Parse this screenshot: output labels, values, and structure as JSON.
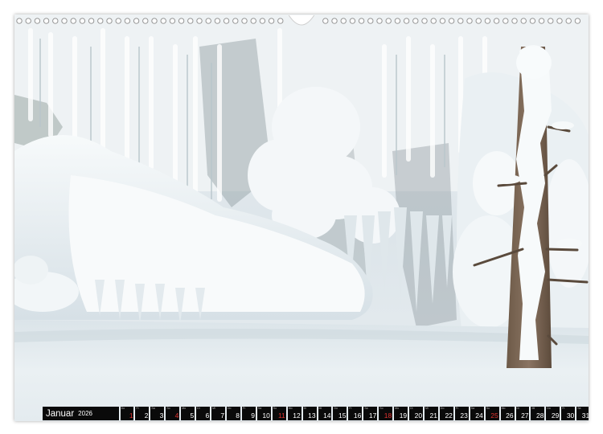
{
  "calendar": {
    "month": "Januar",
    "year": "2026",
    "accent_color": "#e0332f",
    "days": [
      {
        "n": "1",
        "wd": "Do",
        "holiday": true
      },
      {
        "n": "2",
        "wd": "Fr"
      },
      {
        "n": "3",
        "wd": "Sa"
      },
      {
        "n": "4",
        "wd": "So",
        "sunday": true
      },
      {
        "n": "5",
        "wd": "Mo"
      },
      {
        "n": "6",
        "wd": "Di"
      },
      {
        "n": "7",
        "wd": "Mi"
      },
      {
        "n": "8",
        "wd": "Do"
      },
      {
        "n": "9",
        "wd": "Fr"
      },
      {
        "n": "10",
        "wd": "Sa"
      },
      {
        "n": "11",
        "wd": "So",
        "sunday": true
      },
      {
        "n": "12",
        "wd": "Mo"
      },
      {
        "n": "13",
        "wd": "Di"
      },
      {
        "n": "14",
        "wd": "Mi"
      },
      {
        "n": "15",
        "wd": "Do"
      },
      {
        "n": "16",
        "wd": "Fr"
      },
      {
        "n": "17",
        "wd": "Sa"
      },
      {
        "n": "18",
        "wd": "So",
        "sunday": true
      },
      {
        "n": "19",
        "wd": "Mo"
      },
      {
        "n": "20",
        "wd": "Di"
      },
      {
        "n": "21",
        "wd": "Mi"
      },
      {
        "n": "22",
        "wd": "Do"
      },
      {
        "n": "23",
        "wd": "Fr"
      },
      {
        "n": "24",
        "wd": "Sa"
      },
      {
        "n": "25",
        "wd": "So",
        "sunday": true
      },
      {
        "n": "26",
        "wd": "Mo"
      },
      {
        "n": "27",
        "wd": "Di"
      },
      {
        "n": "28",
        "wd": "Mi"
      },
      {
        "n": "29",
        "wd": "Do"
      },
      {
        "n": "30",
        "wd": "Fr"
      },
      {
        "n": "31",
        "wd": "Sa"
      }
    ]
  },
  "photo": {
    "subject": "frozen-waterfall-with-icicles-and-snow-covered-tree-trunk"
  }
}
